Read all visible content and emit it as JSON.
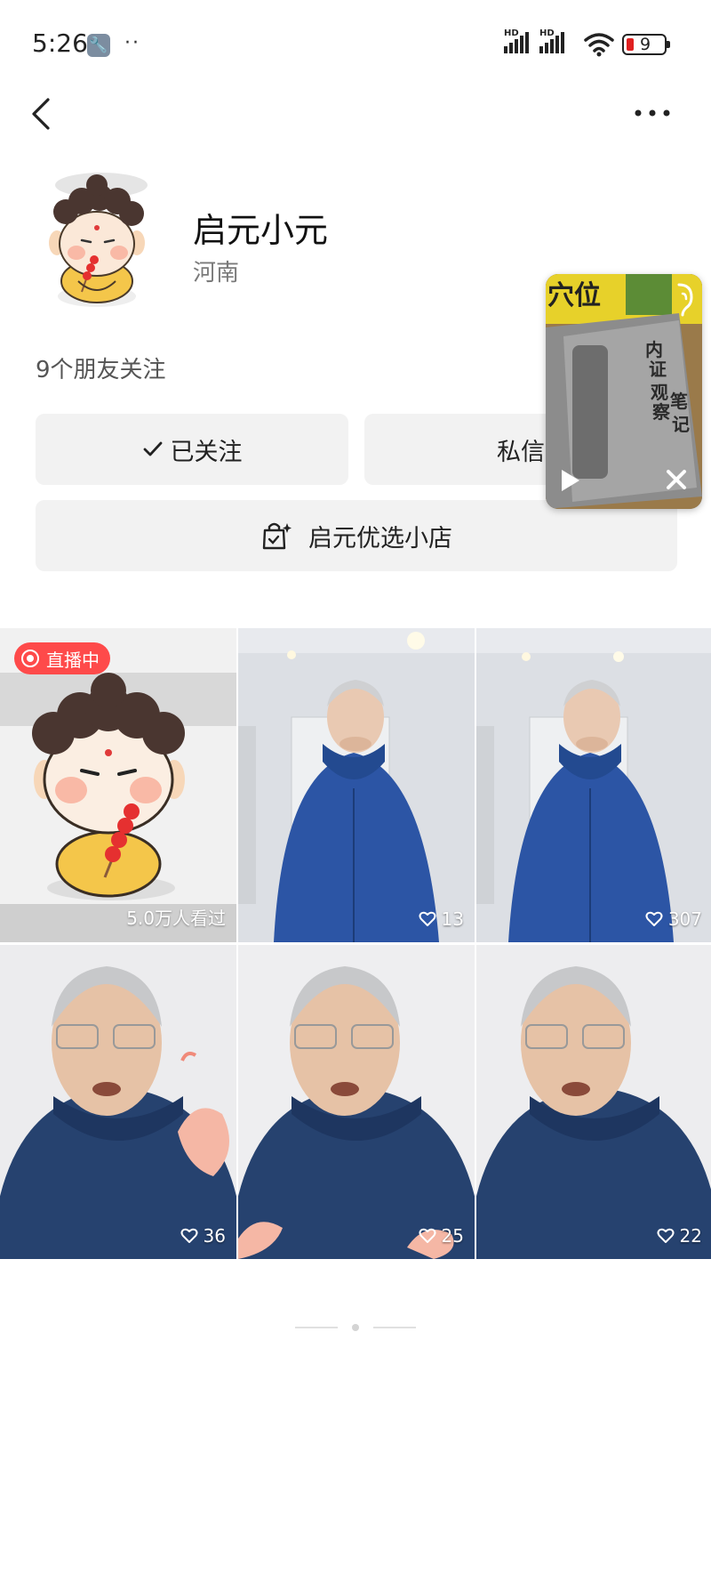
{
  "status_bar": {
    "time": "5:26",
    "icons": [
      "wrench-icon",
      "dots-icon",
      "signal-icon",
      "signal-icon",
      "wifi-icon",
      "battery-icon"
    ],
    "hd_label": "HD",
    "battery_level": "9"
  },
  "nav": {
    "back_icon": "chevron-left-icon",
    "more_icon": "more-horizontal-icon"
  },
  "profile": {
    "name": "启元小元",
    "location": "河南",
    "friends_following": "9个朋友关注"
  },
  "actions": {
    "followed_label": "已关注",
    "message_label": "私信",
    "shop_label": "启元优选小店"
  },
  "mini_player": {
    "icons": [
      "ear-icon",
      "play-icon",
      "close-icon"
    ],
    "book_cover_text": [
      "内",
      "证",
      "观",
      "察",
      "笔",
      "记"
    ],
    "banner_text": "穴位"
  },
  "videos": [
    {
      "type": "live",
      "badge": "直播中",
      "views": "5.0万人看过"
    },
    {
      "type": "video",
      "likes": "13"
    },
    {
      "type": "video",
      "likes": "307"
    },
    {
      "type": "video",
      "likes": "36"
    },
    {
      "type": "video",
      "likes": "25"
    },
    {
      "type": "video",
      "likes": "22"
    }
  ],
  "colors": {
    "live_badge": "#fe4a4a",
    "button_bg": "#f2f2f2",
    "jacket_blue": "#2c55a5",
    "avatar_robe": "#f4c64a"
  },
  "pagination": {
    "count": 3,
    "active": 1
  }
}
